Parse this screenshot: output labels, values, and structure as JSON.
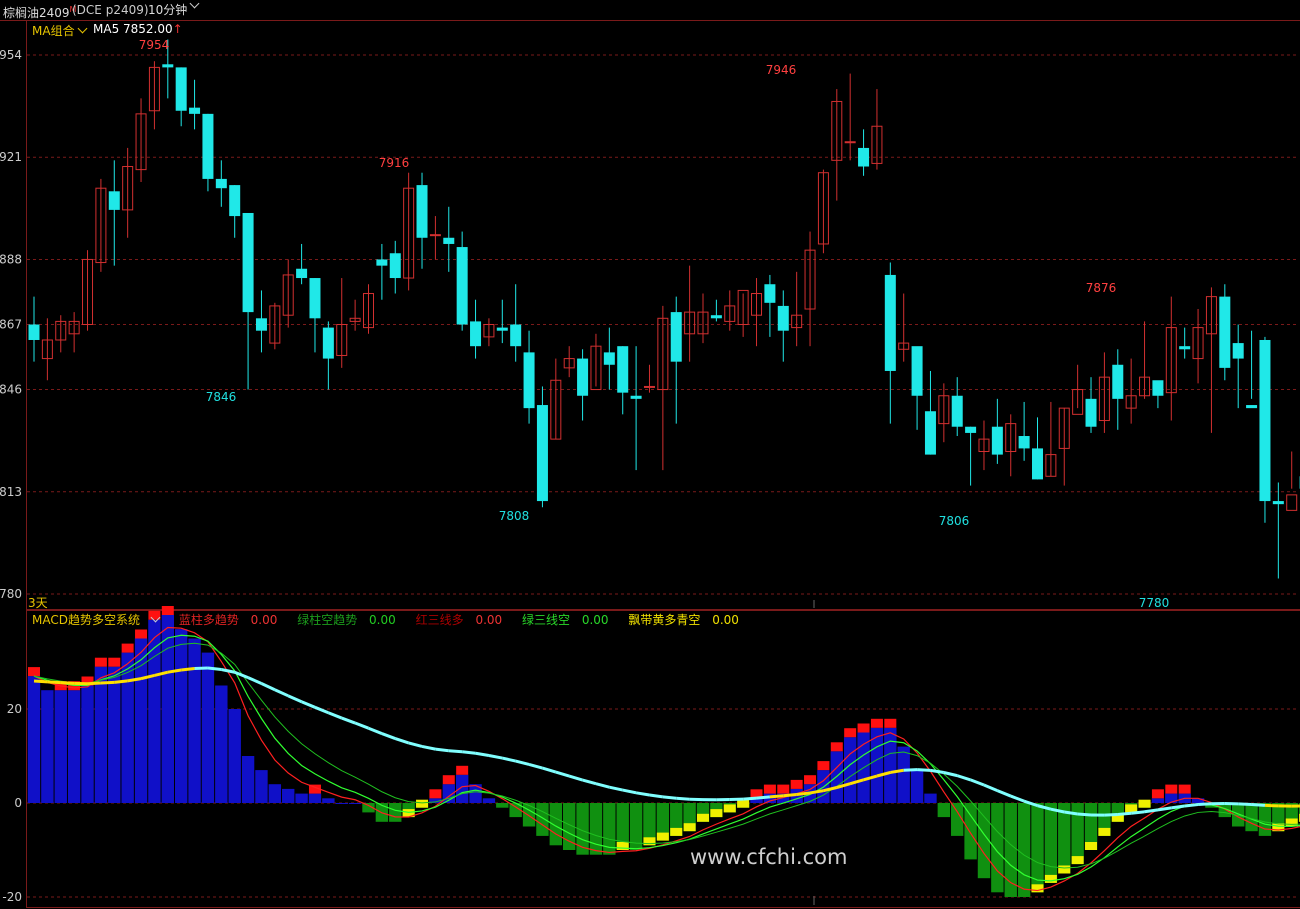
{
  "header": {
    "symbol": "棕榈油2409",
    "symbol_mark": "M",
    "code": "(DCE  p2409)",
    "period": "10分钟"
  },
  "price_panel": {
    "ma_selector": "MA组合",
    "ma_value": "MA5 7852.00",
    "ma_arrow": "↑",
    "period_note": "3天",
    "y_ticks": [
      "7954",
      "7921",
      "7888",
      "7867",
      "7846",
      "7813",
      "7780"
    ]
  },
  "macd_panel": {
    "title": "MACD趋势多空系统",
    "legend": [
      {
        "text": "蓝柱多趋势",
        "value": "0.00",
        "color": "#d22"
      },
      {
        "text": "绿柱空趋势",
        "value": "0.00",
        "color": "#1c9c1c"
      },
      {
        "text": "红三线多",
        "value": "0.00",
        "color": "#d22"
      },
      {
        "text": "绿三线空",
        "value": "0.00",
        "color": "#29d829"
      },
      {
        "text": "飘带黄多青空",
        "value": "0.00",
        "color": "#f0e000"
      }
    ],
    "y_ticks": [
      "20",
      "0",
      "-20"
    ]
  },
  "watermark": "www.cfchi.com",
  "colors": {
    "up": "#d23030",
    "down": "#20e8e8",
    "grid": "#7a1a1a",
    "blue_bar": "#1010c8",
    "green_bar": "#109010"
  },
  "chart_data": {
    "type": "candlestick",
    "annotations": [
      {
        "label": "7954",
        "color": "red"
      },
      {
        "label": "7916",
        "color": "red"
      },
      {
        "label": "7946",
        "color": "red"
      },
      {
        "label": "7876",
        "color": "red"
      },
      {
        "label": "7846",
        "color": "cyan"
      },
      {
        "label": "7808",
        "color": "cyan"
      },
      {
        "label": "7806",
        "color": "cyan"
      },
      {
        "label": "7780",
        "color": "cyan"
      }
    ],
    "candles": [
      [
        7867,
        7862,
        7876,
        7855
      ],
      [
        7856,
        7862,
        7869,
        7849
      ],
      [
        7862,
        7868,
        7870,
        7858
      ],
      [
        7864,
        7868,
        7871,
        7858
      ],
      [
        7867,
        7888,
        7891,
        7865
      ],
      [
        7887,
        7911,
        7914,
        7884
      ],
      [
        7910,
        7904,
        7920,
        7886
      ],
      [
        7904,
        7918,
        7924,
        7895
      ],
      [
        7917,
        7935,
        7940,
        7913
      ],
      [
        7936,
        7950,
        7952,
        7930
      ],
      [
        7951,
        7950,
        7959,
        7940
      ],
      [
        7950,
        7936,
        7950,
        7931
      ],
      [
        7937,
        7935,
        7946,
        7930
      ],
      [
        7935,
        7914,
        7935,
        7910
      ],
      [
        7914,
        7911,
        7920,
        7905
      ],
      [
        7912,
        7902,
        7912,
        7895
      ],
      [
        7903,
        7871,
        7900,
        7846
      ],
      [
        7869,
        7865,
        7878,
        7858
      ],
      [
        7861,
        7873,
        7874,
        7859
      ],
      [
        7870,
        7883,
        7888,
        7866
      ],
      [
        7885,
        7882,
        7893,
        7880
      ],
      [
        7882,
        7869,
        7882,
        7858
      ],
      [
        7866,
        7856,
        7868,
        7846
      ],
      [
        7857,
        7867,
        7882,
        7853
      ],
      [
        7868,
        7869,
        7875,
        7865
      ],
      [
        7866,
        7877,
        7880,
        7864
      ],
      [
        7888,
        7886,
        7893,
        7875
      ],
      [
        7890,
        7882,
        7894,
        7877
      ],
      [
        7882,
        7911,
        7916,
        7878
      ],
      [
        7912,
        7895,
        7916,
        7885
      ],
      [
        7896,
        7896,
        7902,
        7888
      ],
      [
        7895,
        7893,
        7905,
        7884
      ],
      [
        7892,
        7867,
        7897,
        7865
      ],
      [
        7868,
        7860,
        7875,
        7856
      ],
      [
        7863,
        7867,
        7869,
        7860
      ],
      [
        7866,
        7865,
        7875,
        7861
      ],
      [
        7867,
        7860,
        7880,
        7855
      ],
      [
        7858,
        7840,
        7865,
        7835
      ],
      [
        7841,
        7810,
        7847,
        7808
      ],
      [
        7830,
        7849,
        7856,
        7830
      ],
      [
        7853,
        7856,
        7860,
        7850
      ],
      [
        7856,
        7844,
        7859,
        7836
      ],
      [
        7846,
        7860,
        7864,
        7847
      ],
      [
        7858,
        7854,
        7866,
        7846
      ],
      [
        7860,
        7845,
        7860,
        7838
      ],
      [
        7844,
        7843,
        7860,
        7820
      ],
      [
        7847,
        7847,
        7854,
        7845
      ],
      [
        7846,
        7869,
        7873,
        7820
      ],
      [
        7871,
        7855,
        7876,
        7835
      ],
      [
        7864,
        7871,
        7886,
        7855
      ],
      [
        7864,
        7871,
        7877,
        7861
      ],
      [
        7870,
        7869,
        7875,
        7868
      ],
      [
        7868,
        7873,
        7878,
        7865
      ],
      [
        7867,
        7878,
        7877,
        7863
      ],
      [
        7870,
        7877,
        7882,
        7860
      ],
      [
        7880,
        7874,
        7883,
        7863
      ],
      [
        7873,
        7865,
        7878,
        7855
      ],
      [
        7866,
        7870,
        7884,
        7860
      ],
      [
        7872,
        7891,
        7897,
        7860
      ],
      [
        7893,
        7916,
        7917,
        7890
      ],
      [
        7920,
        7939,
        7943,
        7907
      ],
      [
        7926,
        7926,
        7948,
        7920
      ],
      [
        7924,
        7918,
        7930,
        7915
      ],
      [
        7919,
        7931,
        7943,
        7917
      ],
      [
        7883,
        7852,
        7887,
        7835
      ],
      [
        7859,
        7861,
        7877,
        7855
      ],
      [
        7860,
        7844,
        7859,
        7833
      ],
      [
        7839,
        7825,
        7852,
        7825
      ],
      [
        7835,
        7844,
        7848,
        7829
      ],
      [
        7844,
        7834,
        7850,
        7831
      ],
      [
        7834,
        7832,
        7834,
        7815
      ],
      [
        7826,
        7830,
        7836,
        7820
      ],
      [
        7834,
        7825,
        7843,
        7822
      ],
      [
        7826,
        7835,
        7838,
        7818
      ],
      [
        7831,
        7827,
        7842,
        7823
      ],
      [
        7827,
        7817,
        7837,
        7817
      ],
      [
        7818,
        7825,
        7842,
        7818
      ],
      [
        7827,
        7840,
        7840,
        7815
      ],
      [
        7838,
        7846,
        7854,
        7840
      ],
      [
        7843,
        7834,
        7850,
        7832
      ],
      [
        7836,
        7850,
        7858,
        7832
      ],
      [
        7854,
        7843,
        7859,
        7833
      ],
      [
        7840,
        7844,
        7856,
        7835
      ],
      [
        7844,
        7850,
        7868,
        7843
      ],
      [
        7849,
        7844,
        7848,
        7840
      ],
      [
        7845,
        7866,
        7876,
        7836
      ],
      [
        7860,
        7859,
        7866,
        7856
      ],
      [
        7856,
        7866,
        7872,
        7848
      ],
      [
        7864,
        7876,
        7879,
        7832
      ],
      [
        7876,
        7853,
        7880,
        7849
      ],
      [
        7861,
        7856,
        7867,
        7840
      ],
      [
        7841,
        7840,
        7865,
        7843
      ],
      [
        7862,
        7810,
        7863,
        7803
      ],
      [
        7810,
        7809,
        7816,
        7785
      ],
      [
        7807,
        7812,
        7826,
        7814
      ],
      [
        7818,
        7814,
        7820,
        7813
      ],
      [
        7813,
        7820,
        7826,
        7810
      ],
      [
        7822,
        7851,
        7858,
        7812
      ],
      [
        7850,
        7849,
        7860,
        7840
      ],
      [
        7855,
        7867,
        7876,
        7849
      ],
      [
        7870,
        7862,
        7881,
        7849
      ],
      [
        7862,
        7868,
        7875,
        7860
      ],
      [
        7863,
        7863,
        7871,
        7858
      ]
    ],
    "macd": {
      "hist": [
        27,
        24,
        24,
        24,
        25,
        29,
        29,
        32,
        35,
        39,
        40,
        37,
        35,
        32,
        25,
        20,
        10,
        7,
        4,
        3,
        2,
        2,
        1,
        0,
        0,
        -2,
        -4,
        -4,
        -3,
        -1,
        1,
        4,
        6,
        4,
        1,
        -1,
        -3,
        -5,
        -7,
        -9,
        -10,
        -11,
        -11,
        -11,
        -10,
        -10,
        -9,
        -8,
        -7,
        -6,
        -4,
        -3,
        -2,
        -1,
        1,
        2,
        2,
        3,
        4,
        7,
        11,
        14,
        15,
        16,
        16,
        12,
        7,
        2,
        -3,
        -7,
        -12,
        -16,
        -19,
        -20,
        -20,
        -19,
        -17,
        -15,
        -13,
        -10,
        -7,
        -4,
        -2,
        -1,
        1,
        2,
        2,
        1,
        -1,
        -3,
        -5,
        -6,
        -7,
        -6,
        -5,
        -4,
        -2,
        -1,
        0,
        1,
        2
      ],
      "ribbon_yellow": [
        19,
        20,
        20,
        20,
        21,
        21,
        22,
        23,
        24,
        25,
        25,
        25
      ],
      "ribbon_cyan_start": 25,
      "ribbon_cyan_end": 0
    }
  }
}
